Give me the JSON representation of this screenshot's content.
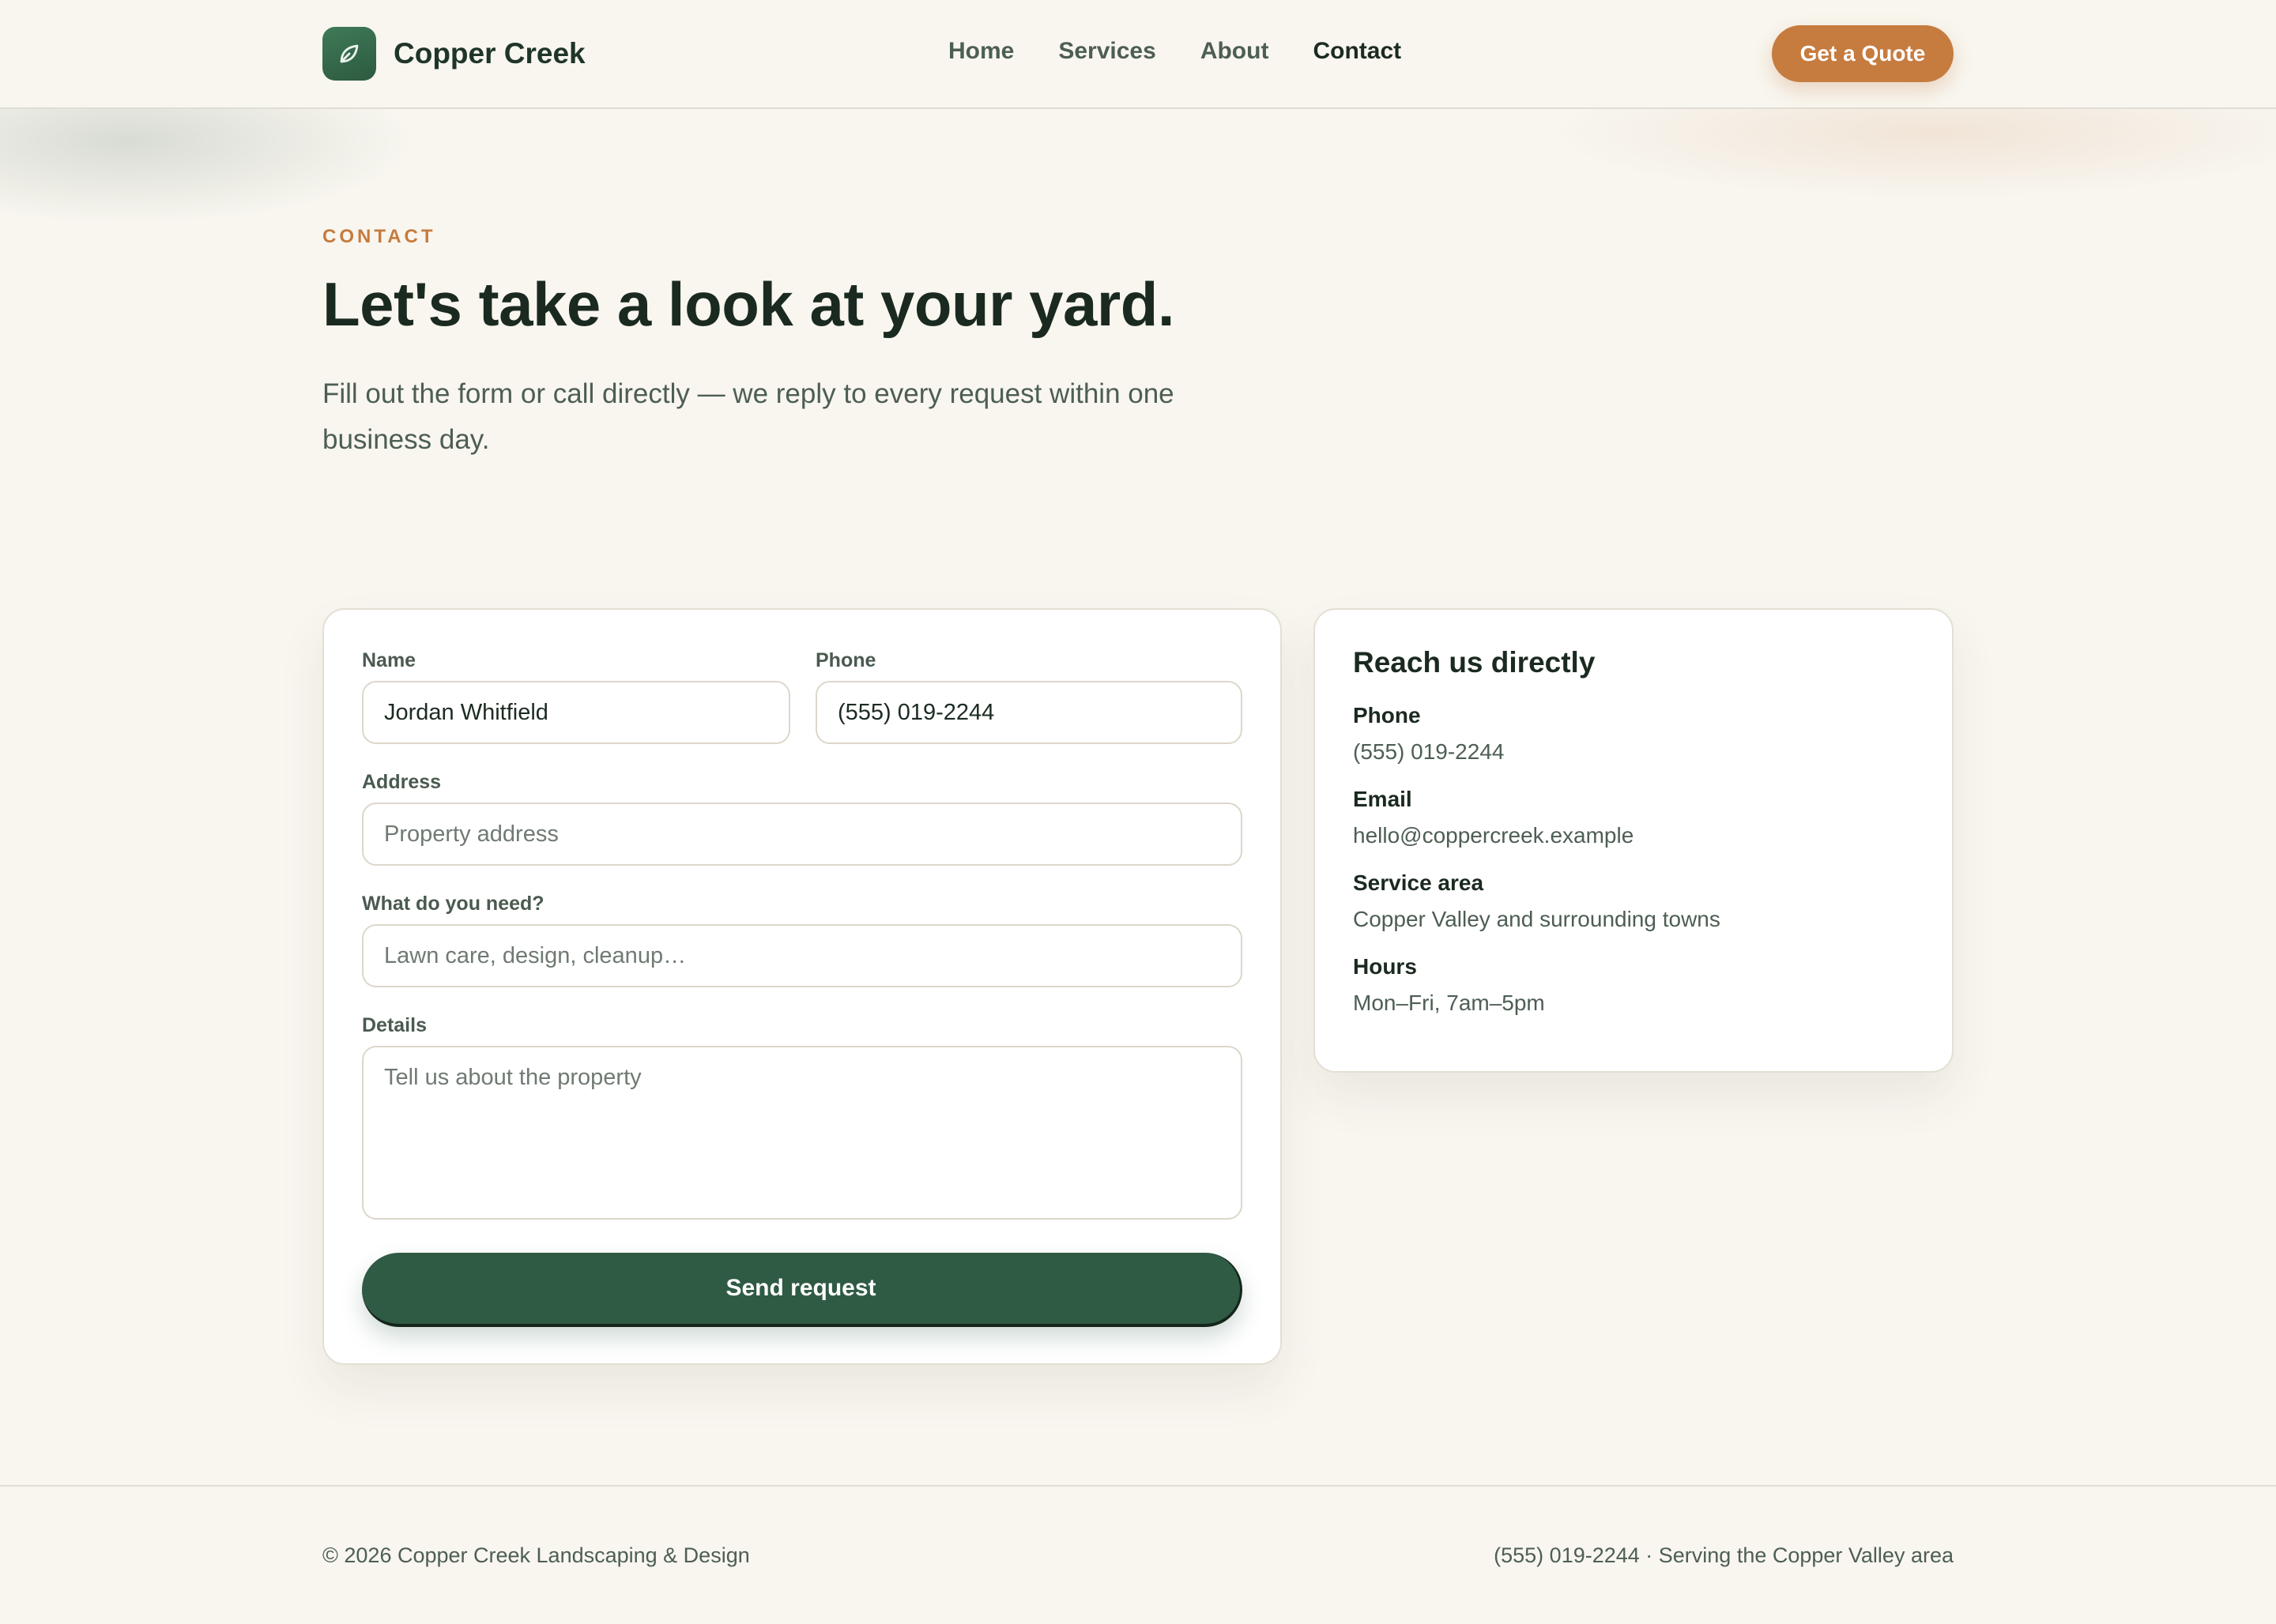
{
  "header": {
    "brand_name": "Copper Creek",
    "nav": [
      {
        "label": "Home",
        "active": false
      },
      {
        "label": "Services",
        "active": false
      },
      {
        "label": "About",
        "active": false
      },
      {
        "label": "Contact",
        "active": true
      }
    ],
    "cta_label": "Get a Quote"
  },
  "hero": {
    "eyebrow": "CONTACT",
    "headline": "Let's take a look at your yard.",
    "subtext": "Fill out the form or call directly — we reply to every request within one business day."
  },
  "form": {
    "name": {
      "label": "Name",
      "value": "Jordan Whitfield",
      "placeholder": ""
    },
    "phone": {
      "label": "Phone",
      "value": "(555) 019-2244",
      "placeholder": ""
    },
    "address": {
      "label": "Address",
      "value": "",
      "placeholder": "Property address"
    },
    "need": {
      "label": "What do you need?",
      "value": "",
      "placeholder": "Lawn care, design, cleanup…"
    },
    "details": {
      "label": "Details",
      "value": "",
      "placeholder": "Tell us about the property"
    },
    "submit_label": "Send request"
  },
  "contact_info": {
    "title": "Reach us directly",
    "items": [
      {
        "label": "Phone",
        "value": "(555) 019-2244"
      },
      {
        "label": "Email",
        "value": "hello@coppercreek.example"
      },
      {
        "label": "Service area",
        "value": "Copper Valley and surrounding towns"
      },
      {
        "label": "Hours",
        "value": "Mon–Fri, 7am–5pm"
      }
    ]
  },
  "footer": {
    "copyright": "© 2026 Copper Creek Landscaping & Design",
    "tagline": "(555) 019-2244 · Serving the Copper Valley area"
  },
  "icons": {
    "logo": "leaf-icon"
  },
  "colors": {
    "accent": "#c67b3f",
    "primary": "#2f5a43",
    "background": "#f8f6ef"
  }
}
